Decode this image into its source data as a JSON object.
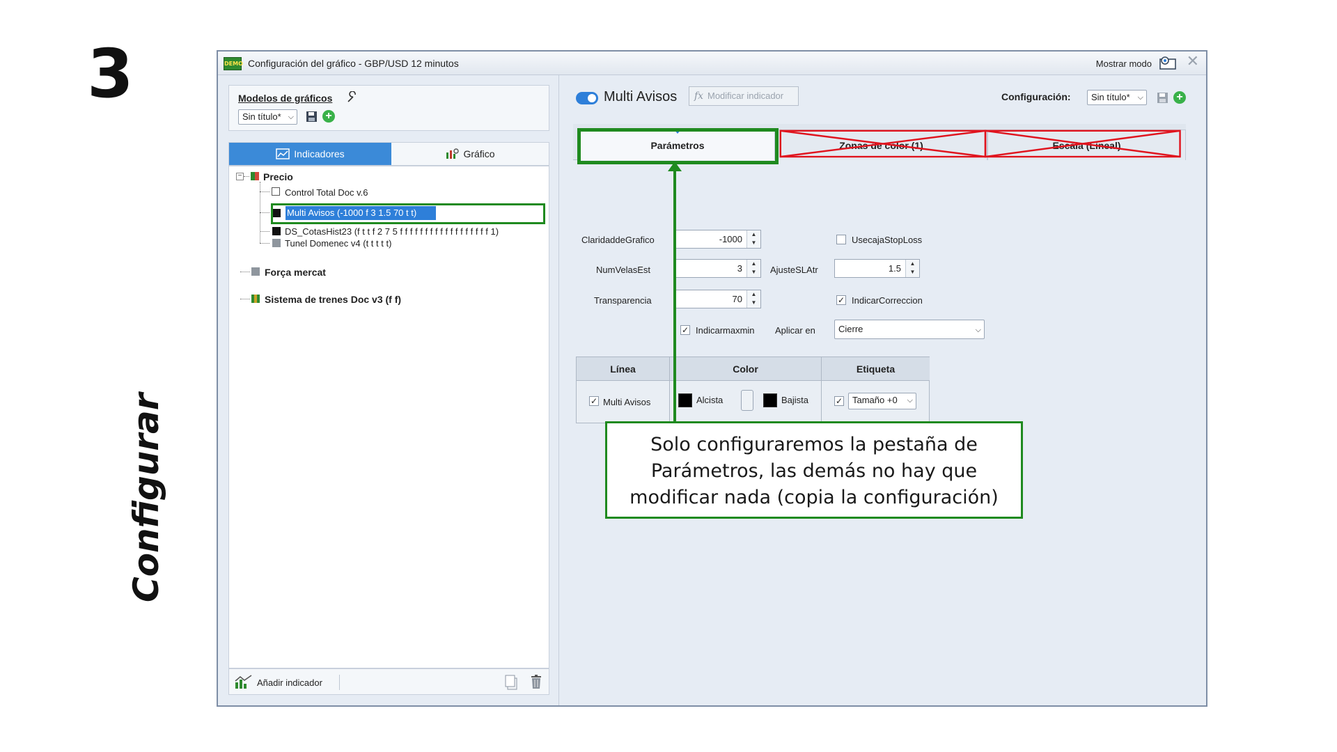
{
  "slide": {
    "number": "3",
    "side_title": "Configurar"
  },
  "window": {
    "title": "Configuración del gráfico - GBP/USD 12 minutos",
    "app_badge": "DEMO",
    "show_mode_label": "Mostrar modo"
  },
  "left": {
    "models_title": "Modelos de gráficos",
    "model_select": "Sin título*",
    "tabs": {
      "indicators": "Indicadores",
      "chart": "Gráfico"
    },
    "tree": {
      "precio": "Precio",
      "items": [
        "Control Total Doc v.6",
        "Multi Avisos (-1000 f 3 1.5 70 t t)",
        "DS_CotasHist23 (f t t f 2 7 5 f f f f f f f f f f f f f f f f f f 1)",
        "Tunel Domenec v4 (t t t t t)"
      ],
      "forca": "Força mercat",
      "sistema": "Sistema de trenes Doc v3 (f f)"
    },
    "footer": {
      "add_indicator": "Añadir indicador"
    }
  },
  "right": {
    "indicator_name": "Multi Avisos",
    "modify_label": "Modificar indicador",
    "config_label": "Configuración:",
    "config_select": "Sin título*",
    "tabs": [
      "Parámetros",
      "Zonas de color (1)",
      "Escala (Lineal)"
    ],
    "params": {
      "claridad_label": "ClaridaddeGrafico",
      "claridad_value": "-1000",
      "numvelas_label": "NumVelasEst",
      "numvelas_value": "3",
      "ajuste_label": "AjusteSLAtr",
      "ajuste_value": "1.5",
      "transp_label": "Transparencia",
      "transp_value": "70",
      "usecaja_label": "UsecajaStopLoss",
      "indcorr_label": "IndicarCorreccion",
      "indmaxmin_label": "Indicarmaxmin",
      "aplicar_label": "Aplicar en",
      "aplicar_value": "Cierre"
    },
    "line_table": {
      "headers": [
        "Línea",
        "Color",
        "Etiqueta"
      ],
      "line_name": "Multi Avisos",
      "alcista": "Alcista",
      "bajista": "Bajista",
      "size_select": "Tamaño +0"
    }
  },
  "annotation": {
    "line1": "Solo configuraremos la pestaña de",
    "line2": "Parámetros, las demás no hay que",
    "line3": "modificar nada (copia la configuración)"
  },
  "colors": {
    "accent_blue": "#2e7fd9",
    "highlight_green": "#1f8a1f",
    "cross_red": "#e0141e"
  }
}
